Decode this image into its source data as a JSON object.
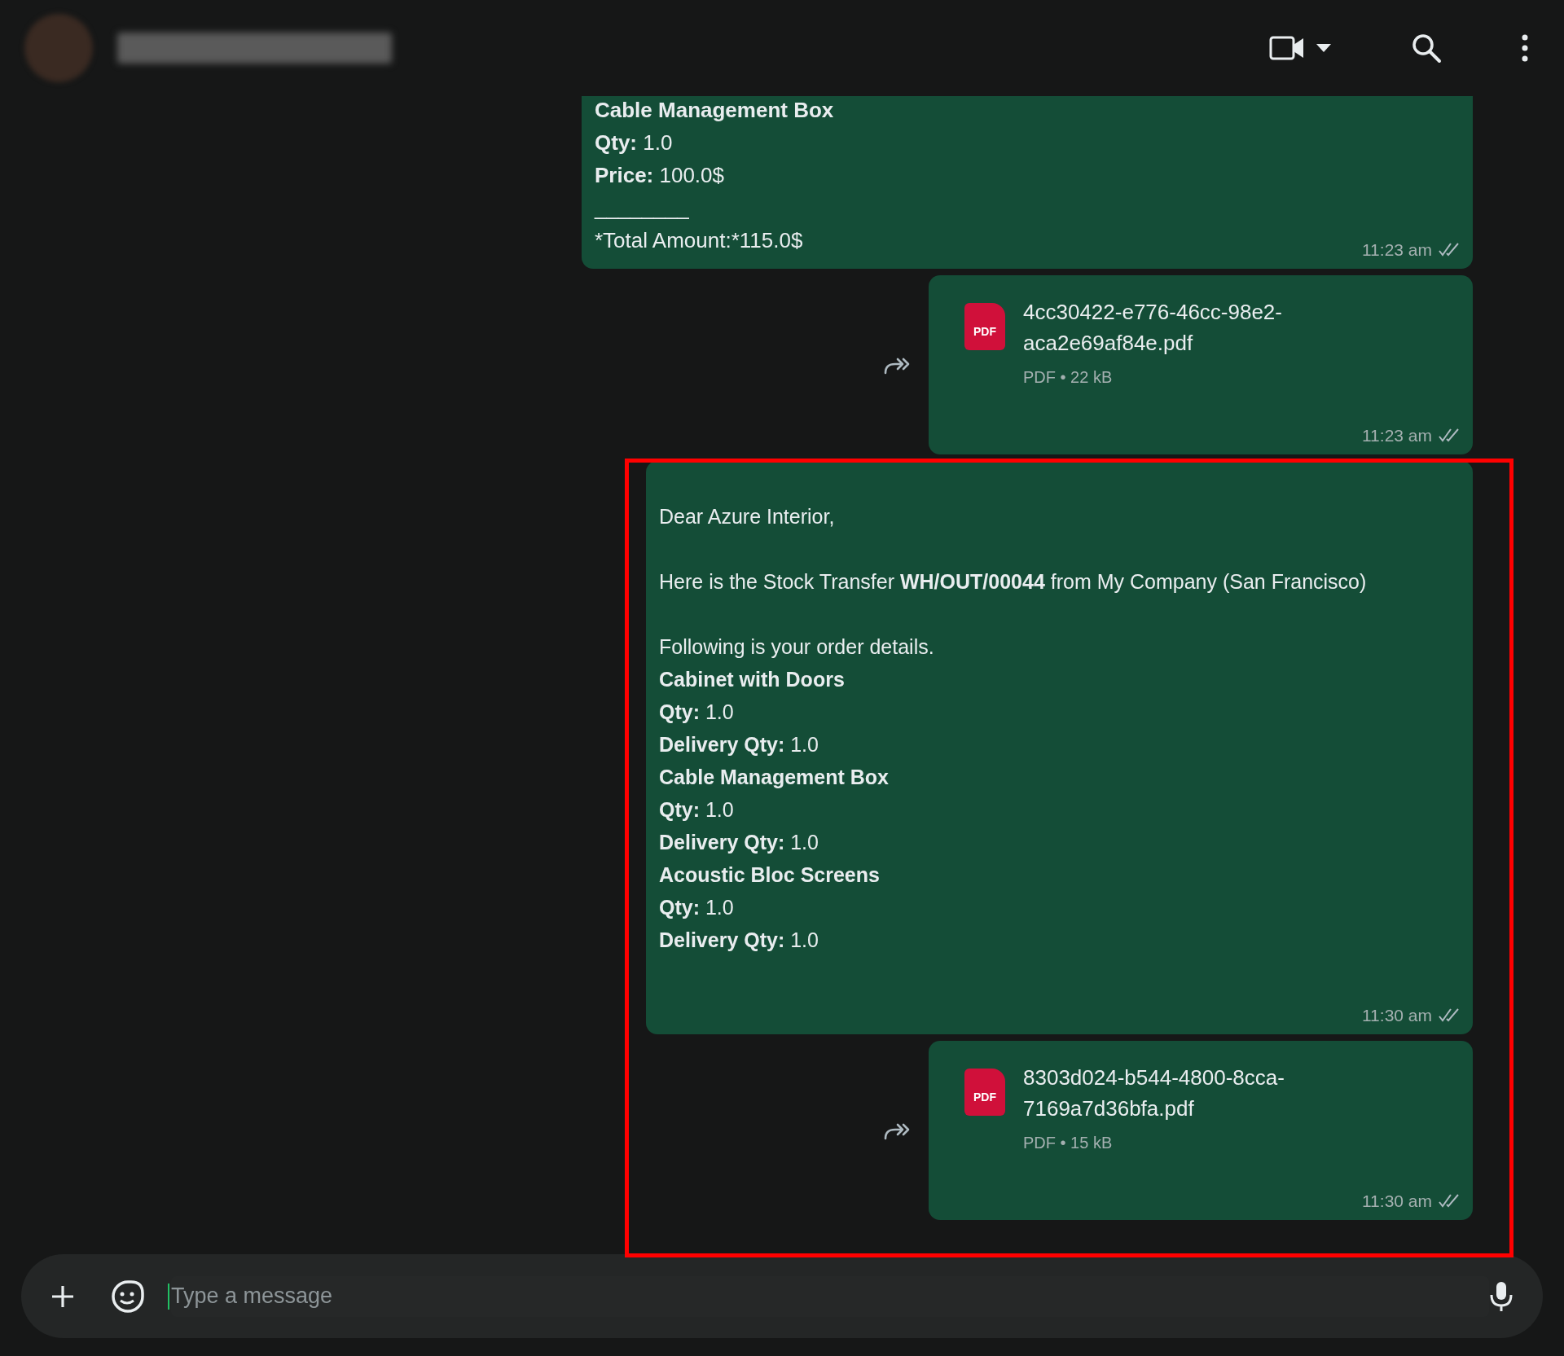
{
  "messages": [
    {
      "kind": "text",
      "paragraphs": [
        [
          [
            {
              "text": "Cable Management Box",
              "bold": true
            }
          ],
          [
            {
              "text": "Qty:",
              "bold": true
            },
            {
              "text": " 1.0",
              "bold": false
            }
          ],
          [
            {
              "text": "Price:",
              "bold": true
            },
            {
              "text": " 100.0$",
              "bold": false
            }
          ],
          [
            {
              "text": "________",
              "bold": false
            }
          ],
          [
            {
              "text": "*Total Amount:*115.0$",
              "bold": false
            }
          ]
        ]
      ],
      "time": "11:23 am"
    },
    {
      "kind": "document",
      "icon_label": "PDF",
      "filename": "4cc30422-e776-46cc-98e2-aca2e69af84e.pdf",
      "meta": "PDF • 22 kB",
      "time": "11:23 am"
    },
    {
      "kind": "text",
      "paragraphs": [
        [
          [
            {
              "text": "Dear Azure Interior,",
              "bold": false
            }
          ]
        ],
        [
          [
            {
              "text": "Here is the Stock Transfer ",
              "bold": false
            },
            {
              "text": "WH/OUT/00044",
              "bold": true
            },
            {
              "text": " from My Company (San Francisco)",
              "bold": false
            }
          ]
        ],
        [
          [
            {
              "text": "Following is your order details.",
              "bold": false
            }
          ],
          [
            {
              "text": "Cabinet with Doors",
              "bold": true
            }
          ],
          [
            {
              "text": "Qty:",
              "bold": true
            },
            {
              "text": " 1.0",
              "bold": false
            }
          ],
          [
            {
              "text": "Delivery Qty:",
              "bold": true
            },
            {
              "text": " 1.0",
              "bold": false
            }
          ],
          [
            {
              "text": "Cable Management Box",
              "bold": true
            }
          ],
          [
            {
              "text": "Qty:",
              "bold": true
            },
            {
              "text": " 1.0",
              "bold": false
            }
          ],
          [
            {
              "text": "Delivery Qty:",
              "bold": true
            },
            {
              "text": " 1.0",
              "bold": false
            }
          ],
          [
            {
              "text": "Acoustic Bloc Screens",
              "bold": true
            }
          ],
          [
            {
              "text": "Qty:",
              "bold": true
            },
            {
              "text": " 1.0",
              "bold": false
            }
          ],
          [
            {
              "text": "Delivery Qty:",
              "bold": true
            },
            {
              "text": " 1.0",
              "bold": false
            }
          ]
        ]
      ],
      "time": "11:30 am"
    },
    {
      "kind": "document",
      "icon_label": "PDF",
      "filename": "8303d024-b544-4800-8cca-7169a7d36bfa.pdf",
      "meta": "PDF • 15 kB",
      "time": "11:30 am"
    }
  ],
  "composer": {
    "placeholder": "Type a message"
  }
}
